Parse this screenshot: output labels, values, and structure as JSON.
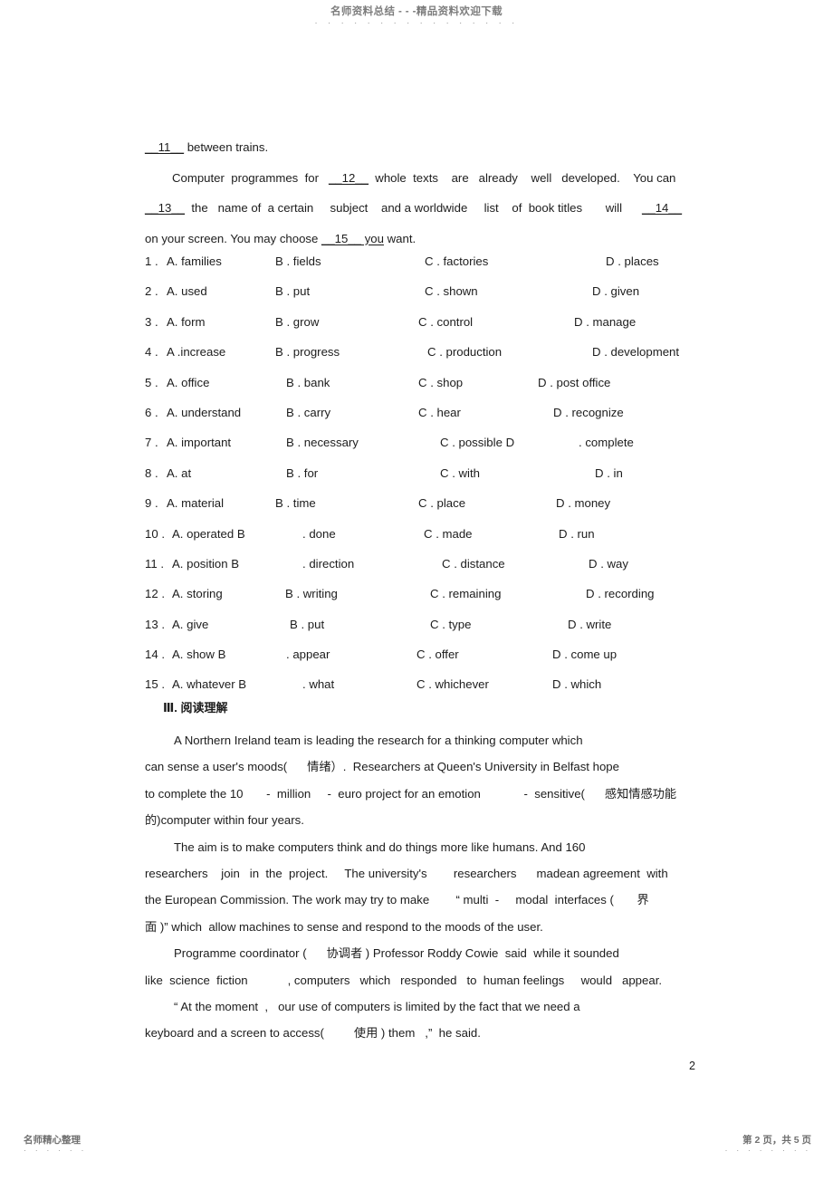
{
  "watermark": {
    "header_text": "名师资料总结 - - -精品资料欢迎下载",
    "header_dots": "· · · · · · · · · · · · · · · ·",
    "footer_left": "名师精心整理",
    "footer_left_dots": "· · · · · ·",
    "footer_right": "第 2 页，共 5 页",
    "footer_right_dots": "· · · · · · · ·"
  },
  "cloze_text": {
    "line1_a": "__11__",
    "line1_b": " between trains.",
    "line2_a": "Computer  programmes  for   ",
    "line2_blank": "__12__",
    "line2_b": "  whole  texts    are   already    well   developed.    You can",
    "line3_a": "__13__",
    "line3_b": "  the   name of  a certain     subject    and a worldwide     list    of  book titles       will      ",
    "line3_blank": "__14__",
    "line4_a": "on your screen. You may choose ",
    "line4_blank": "__15__",
    "line4_u": " you",
    "line4_b": " want."
  },
  "options": [
    {
      "num": "1 . ",
      "a": "A. families",
      "b": "B . fields",
      "c": "C . factories",
      "d": "D . places",
      "x": [
        0,
        68,
        155,
        280
      ]
    },
    {
      "num": "2 . ",
      "a": "A. used",
      "b": "B . put",
      "c": "C . shown",
      "d": "D . given",
      "x": [
        0,
        68,
        155,
        265
      ]
    },
    {
      "num": "3 . ",
      "a": "A. form",
      "b": "B . grow",
      "c": "C . control",
      "d": "D . manage",
      "x": [
        0,
        68,
        148,
        245
      ]
    },
    {
      "num": "4 . ",
      "a": "A .increase",
      "b": "B . progress",
      "c": "C . production",
      "d": "D . development",
      "x": [
        0,
        68,
        158,
        265
      ]
    },
    {
      "num": "5 . ",
      "a": "A. office",
      "b": "B . bank",
      "c": "C . shop",
      "d": "D . post office",
      "x": [
        0,
        80,
        148,
        205
      ]
    },
    {
      "num": "6 . ",
      "a": "A. understand",
      "b": "B . carry",
      "c": "C . hear",
      "d": "D . recognize",
      "x": [
        0,
        80,
        148,
        222
      ]
    },
    {
      "num": "7 . ",
      "a": "A. important",
      "b": "B . necessary",
      "c": "C . possible D",
      "d": ". complete",
      "x": [
        0,
        80,
        172,
        250
      ]
    },
    {
      "num": "8 . ",
      "a": "A. at",
      "b": "B . for",
      "c": "C . with",
      "d": "D . in",
      "x": [
        0,
        80,
        172,
        268
      ]
    },
    {
      "num": "9 . ",
      "a": "A. material",
      "b": "B . time",
      "c": "C . place",
      "d": "D . money",
      "x": [
        0,
        68,
        148,
        225
      ]
    },
    {
      "num": "10 . ",
      "a": "A. operated B",
      "b": ". done",
      "c": "C . made",
      "d": "D . run",
      "x": [
        0,
        92,
        148,
        222
      ]
    },
    {
      "num": "11 . ",
      "a": "A. position B",
      "b": ". direction",
      "c": "C . distance",
      "d": "D . way",
      "x": [
        0,
        92,
        168,
        255
      ]
    },
    {
      "num": "12 . ",
      "a": "A. storing",
      "b": "B . writing",
      "c": "C . remaining",
      "d": "D . recording",
      "x": [
        0,
        73,
        155,
        252
      ]
    },
    {
      "num": "13 . ",
      "a": "A. give",
      "b": "B . put",
      "c": "C . type",
      "d": "D . write",
      "x": [
        0,
        78,
        155,
        232
      ]
    },
    {
      "num": "14 . ",
      "a": "A. show B",
      "b": ". appear",
      "c": "C . offer",
      "d": "D . come up",
      "x": [
        0,
        74,
        140,
        215
      ]
    },
    {
      "num": "15 . ",
      "a": "A. whatever B",
      "b": ". what",
      "c": "C . whichever",
      "d": "D . which",
      "x": [
        0,
        92,
        140,
        215
      ]
    }
  ],
  "section_heading": "Ⅲ. 阅读理解",
  "passage": {
    "p1_l1": "A Northern Ireland team is leading the research for a thinking computer which",
    "p1_l2": "can sense a user's moods(      情绪）.  Researchers at Queen's University in Belfast hope",
    "p1_l3": "to complete the 10       -  million     -  euro project for an emotion             -  sensitive(      感知情感功能",
    "p1_l4": "的)computer within four years.",
    "p2_l1": "The aim is to make computers think and do things more like humans. And 160",
    "p2_l2": "researchers    join   in  the  project.     The university's        researchers      madean agreement  with",
    "p2_l3": "the European Commission. The work may try to make        “ multi  -     modal  interfaces (       界",
    "p2_l4": "面 )” which  allow machines to sense and respond to the moods of the user.",
    "p3_l1": "Programme coordinator (      协调者 ) Professor Roddy Cowie  said  while it sounded",
    "p3_l2": "like  science  fiction            , computers   which   responded   to  human feelings     would   appear.",
    "p4_l1": "“ At the moment  ,   our use of computers is limited by the fact that we need a",
    "p4_l2": "keyboard and a screen to access(         使用 ) them   ,”  he said."
  },
  "page_number": "2"
}
